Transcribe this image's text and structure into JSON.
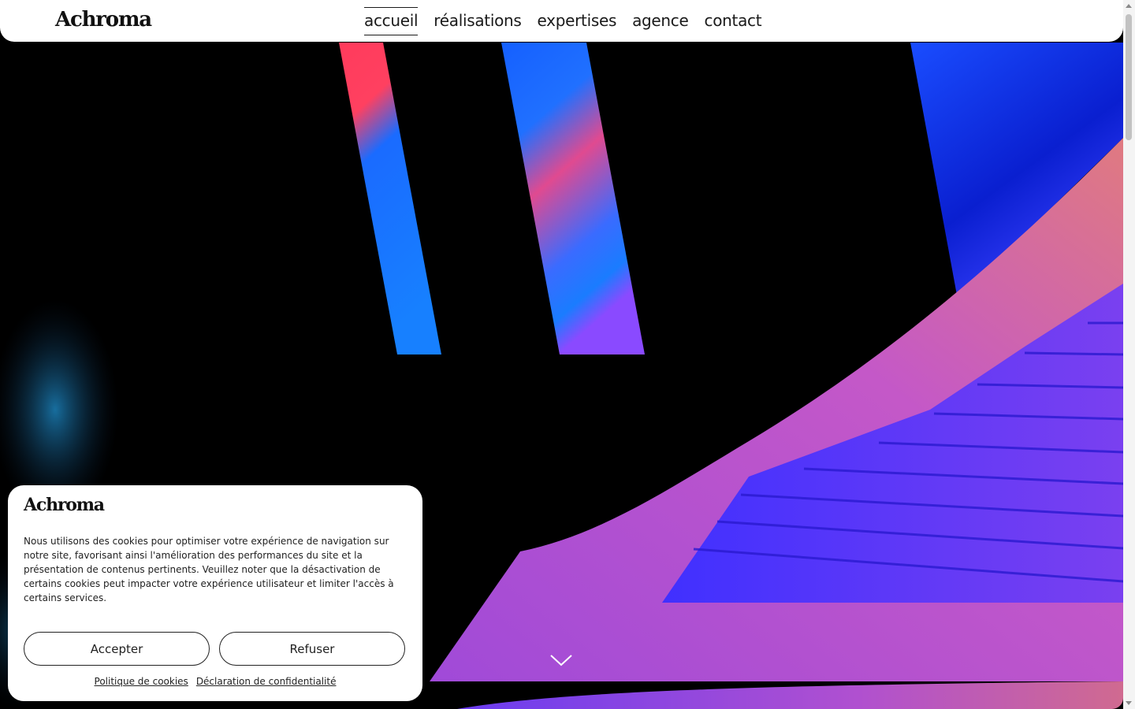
{
  "header": {
    "logo": "Achroma",
    "nav": [
      {
        "label": "accueil",
        "active": true
      },
      {
        "label": "réalisations",
        "active": false
      },
      {
        "label": "expertises",
        "active": false
      },
      {
        "label": "agence",
        "active": false
      },
      {
        "label": "contact",
        "active": false
      }
    ]
  },
  "hero": {
    "scroll_icon": "chevron-down-icon",
    "colors": {
      "background": "#000000",
      "blue": "#1a5cff",
      "purple": "#7a3df0",
      "pink": "#d04ad0"
    }
  },
  "cookie_banner": {
    "logo": "Achroma",
    "text": "Nous utilisons des cookies pour optimiser votre expérience de navigation sur notre site, favorisant ainsi l'amélioration des performances du site et la présentation de contenus pertinents. Veuillez noter que la désactivation de certains cookies peut impacter votre expérience utilisateur et limiter l'accès à certains services.",
    "accept_label": "Accepter",
    "refuse_label": "Refuser",
    "links": [
      "Politique de cookies",
      "Déclaration de confidentialité"
    ]
  }
}
